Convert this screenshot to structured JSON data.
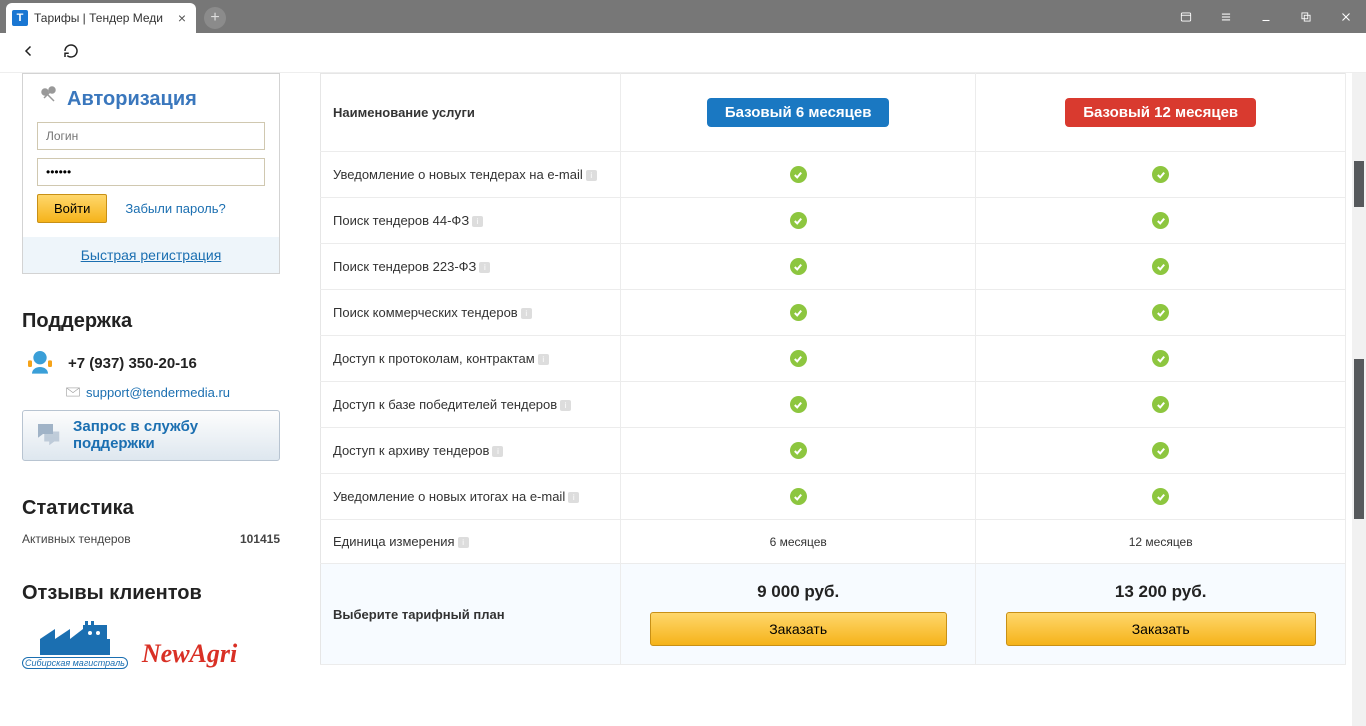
{
  "browser": {
    "tab_title": "Тарифы | Тендер Меди",
    "tab_favicon": "Т"
  },
  "auth": {
    "title": "Авторизация",
    "login_placeholder": "Логин",
    "password_value": "••••••",
    "login_button": "Войти",
    "forgot": "Забыли пароль?",
    "quick_reg": "Быстрая регистрация"
  },
  "support": {
    "title": "Поддержка",
    "phone": "+7 (937) 350-20-16",
    "email": "support@tendermedia.ru",
    "btn_line1": "Запрос в службу",
    "btn_line2": "поддержки"
  },
  "stats": {
    "title": "Статистика",
    "label": "Активных тендеров",
    "value": "101415"
  },
  "testimonials": {
    "title": "Отзывы клиентов",
    "logo1_caption": "Сибирская магистраль",
    "logo2": "NewAgri"
  },
  "pricing": {
    "header": "Наименование услуги",
    "plan1": "Базовый 6 месяцев",
    "plan2": "Базовый 12 месяцев",
    "features": [
      "Уведомление о новых тендерах на e-mail",
      "Поиск тендеров 44-ФЗ",
      "Поиск тендеров 223-ФЗ",
      "Поиск коммерческих тендеров",
      "Доступ к протоколам, контрактам",
      "Доступ к базе победителей тендеров",
      "Доступ к архиву тендеров",
      "Уведомление о новых итогах на e-mail"
    ],
    "unit_label": "Единица измерения",
    "unit1": "6 месяцев",
    "unit2": "12 месяцев",
    "choose_label": "Выберите тарифный план",
    "price1": "9 000 руб.",
    "price2": "13 200 руб.",
    "order": "Заказать"
  }
}
